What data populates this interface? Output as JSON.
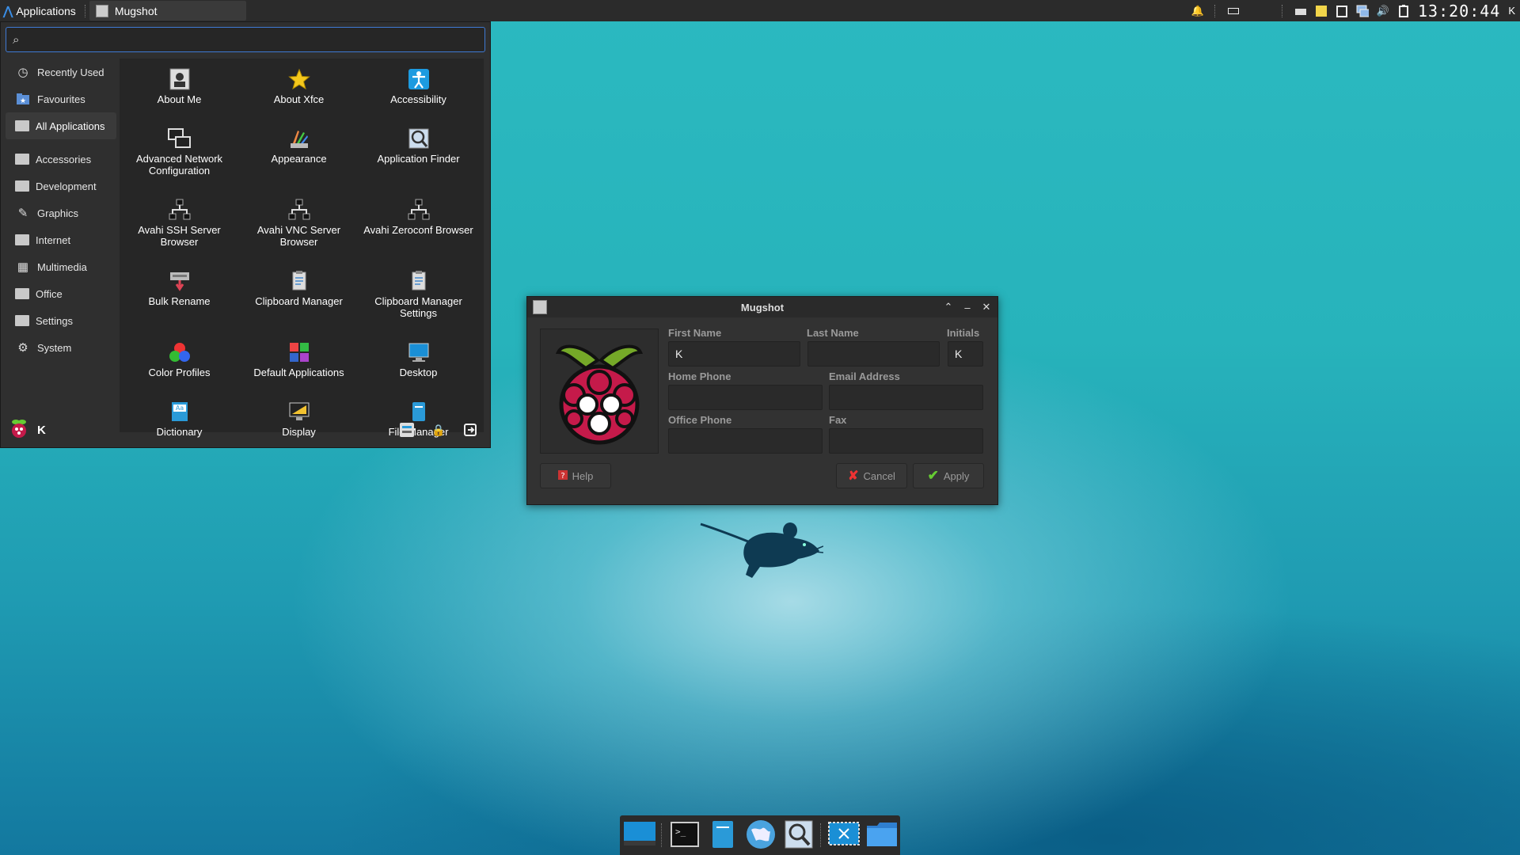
{
  "top_panel": {
    "applications_label": "Applications",
    "task_title": "Mugshot",
    "clock": "13:20:44",
    "user_letter": "K"
  },
  "menu": {
    "search_value": "",
    "categories": [
      {
        "label": "Recently Used",
        "icon": "clock-icon"
      },
      {
        "label": "Favourites",
        "icon": "star-folder-icon"
      },
      {
        "label": "All Applications",
        "icon": "apps-icon"
      },
      {
        "label": "Accessories",
        "icon": "accessories-icon"
      },
      {
        "label": "Development",
        "icon": "development-icon"
      },
      {
        "label": "Graphics",
        "icon": "graphics-icon"
      },
      {
        "label": "Internet",
        "icon": "internet-icon"
      },
      {
        "label": "Multimedia",
        "icon": "multimedia-icon"
      },
      {
        "label": "Office",
        "icon": "office-icon"
      },
      {
        "label": "Settings",
        "icon": "settings-icon"
      },
      {
        "label": "System",
        "icon": "gear-icon"
      }
    ],
    "apps": [
      {
        "label": "About Me",
        "icon": "user-card-icon"
      },
      {
        "label": "About Xfce",
        "icon": "star-icon"
      },
      {
        "label": "Accessibility",
        "icon": "accessibility-icon"
      },
      {
        "label": "Advanced Network Configuration",
        "icon": "network-icon"
      },
      {
        "label": "Appearance",
        "icon": "appearance-icon"
      },
      {
        "label": "Application Finder",
        "icon": "app-finder-icon"
      },
      {
        "label": "Avahi SSH Server Browser",
        "icon": "network-tree-icon"
      },
      {
        "label": "Avahi VNC Server Browser",
        "icon": "network-tree-icon"
      },
      {
        "label": "Avahi Zeroconf Browser",
        "icon": "network-tree-icon"
      },
      {
        "label": "Bulk Rename",
        "icon": "bulk-rename-icon"
      },
      {
        "label": "Clipboard Manager",
        "icon": "clipboard-icon"
      },
      {
        "label": "Clipboard Manager Settings",
        "icon": "clipboard-icon"
      },
      {
        "label": "Color Profiles",
        "icon": "color-profiles-icon"
      },
      {
        "label": "Default Applications",
        "icon": "default-apps-icon"
      },
      {
        "label": "Desktop",
        "icon": "desktop-icon"
      },
      {
        "label": "Dictionary",
        "icon": "dictionary-icon"
      },
      {
        "label": "Display",
        "icon": "display-icon"
      },
      {
        "label": "File Manager",
        "icon": "file-manager-icon"
      }
    ],
    "user_name": "K"
  },
  "dialog": {
    "title": "Mugshot",
    "first_name_label": "First Name",
    "last_name_label": "Last Name",
    "initials_label": "Initials",
    "home_phone_label": "Home Phone",
    "email_label": "Email Address",
    "office_phone_label": "Office Phone",
    "fax_label": "Fax",
    "first_name_value": "K",
    "last_name_value": "",
    "initials_value": "K",
    "home_phone_value": "",
    "email_value": "",
    "office_phone_value": "",
    "fax_value": "",
    "help_label": "Help",
    "cancel_label": "Cancel",
    "apply_label": "Apply"
  },
  "dock": [
    "show-desktop-icon",
    "terminal-icon",
    "file-manager-icon",
    "web-browser-icon",
    "app-finder-icon",
    "screenshot-icon",
    "folder-icon"
  ]
}
